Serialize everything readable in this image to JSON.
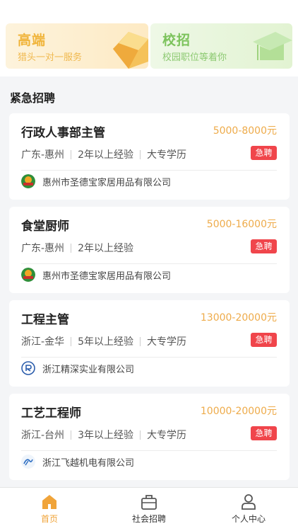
{
  "banners": [
    {
      "title": "高端",
      "subtitle": "猎头一对一服务"
    },
    {
      "title": "校招",
      "subtitle": "校园职位等着你"
    }
  ],
  "section_title": "紧急招聘",
  "urgent_label": "急聘",
  "jobs": [
    {
      "title": "行政人事部主管",
      "salary": "5000-8000元",
      "location": "广东-惠州",
      "experience": "2年以上经验",
      "education": "大专学历",
      "company": "惠州市圣德宝家居用品有限公司"
    },
    {
      "title": "食堂厨师",
      "salary": "5000-16000元",
      "location": "广东-惠州",
      "experience": "2年以上经验",
      "education": "",
      "company": "惠州市圣德宝家居用品有限公司"
    },
    {
      "title": "工程主管",
      "salary": "13000-20000元",
      "location": "浙江-金华",
      "experience": "5年以上经验",
      "education": "大专学历",
      "company": "浙江精深实业有限公司"
    },
    {
      "title": "工艺工程师",
      "salary": "10000-20000元",
      "location": "浙江-台州",
      "experience": "3年以上经验",
      "education": "大专学历",
      "company": "浙江飞越机电有限公司"
    }
  ],
  "tabbar": [
    {
      "label": "首页",
      "icon": "home-icon",
      "active": true
    },
    {
      "label": "社会招聘",
      "icon": "briefcase-icon",
      "active": false
    },
    {
      "label": "个人中心",
      "icon": "user-icon",
      "active": false
    }
  ],
  "colors": {
    "accent": "#f0a43a",
    "urgent": "#f0454b",
    "salary": "#eeab4a"
  }
}
